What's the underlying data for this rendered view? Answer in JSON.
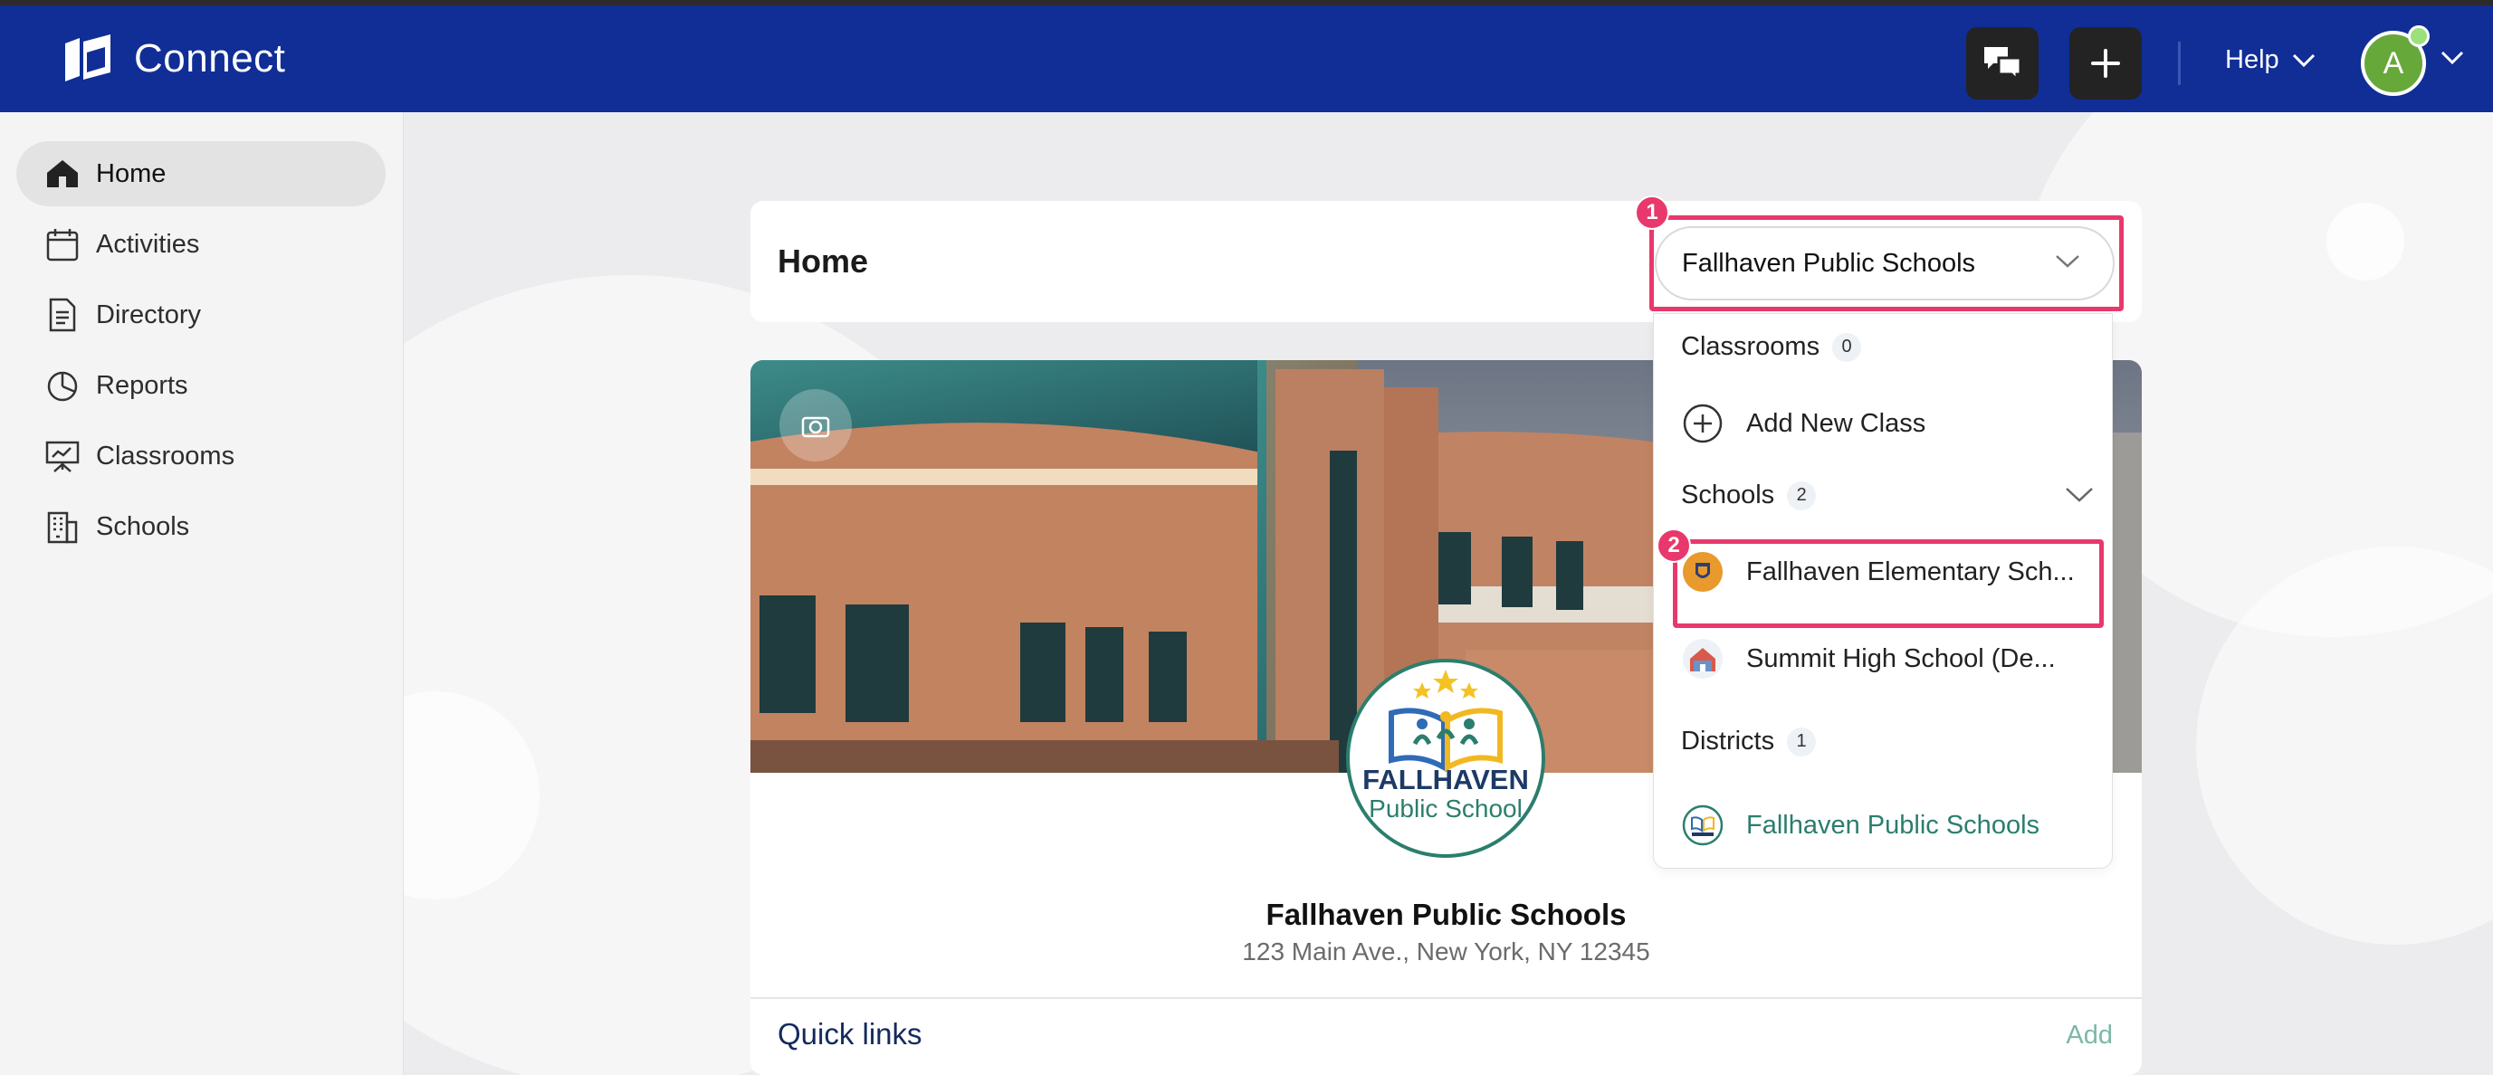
{
  "app": {
    "name": "Connect"
  },
  "topbar": {
    "help_label": "Help",
    "avatar_initial": "A",
    "chat_icon": "chat-bubbles-icon",
    "add_icon": "plus-icon"
  },
  "sidebar": {
    "items": [
      {
        "label": "Home",
        "icon": "home-icon",
        "active": true
      },
      {
        "label": "Activities",
        "icon": "calendar-icon"
      },
      {
        "label": "Directory",
        "icon": "document-icon"
      },
      {
        "label": "Reports",
        "icon": "pie-chart-icon"
      },
      {
        "label": "Classrooms",
        "icon": "presentation-board-icon"
      },
      {
        "label": "Schools",
        "icon": "building-icon"
      }
    ]
  },
  "page": {
    "title": "Home"
  },
  "org_selector": {
    "selected": "Fallhaven Public Schools",
    "sections": {
      "classrooms": {
        "label": "Classrooms",
        "count": "0",
        "add_label": "Add New Class"
      },
      "schools": {
        "label": "Schools",
        "count": "2",
        "items": [
          {
            "label": "Fallhaven Elementary Sch..."
          },
          {
            "label": "Summit High School (De..."
          }
        ]
      },
      "districts": {
        "label": "Districts",
        "count": "1",
        "items": [
          {
            "label": "Fallhaven Public Schools"
          }
        ]
      }
    }
  },
  "annotations": {
    "step1": "1",
    "step2": "2",
    "highlight_color": "#e8386c"
  },
  "profile": {
    "logo_line1": "FALLHAVEN",
    "logo_line2": "Public School",
    "name": "Fallhaven Public Schools",
    "address": "123 Main Ave., New York, NY 12345"
  },
  "quick_links": {
    "title": "Quick links",
    "add_label": "Add"
  },
  "colors": {
    "topbar": "#102e96",
    "accent_green": "#2b7e6d",
    "badge": "#e8386c"
  }
}
